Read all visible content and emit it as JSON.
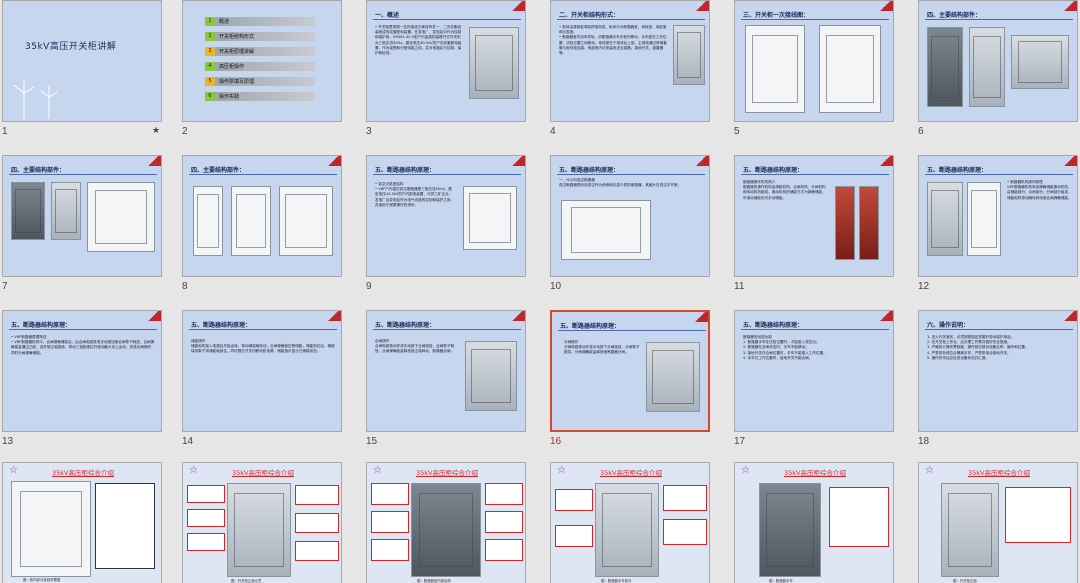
{
  "slides": [
    {
      "num": "1",
      "title": "35kV高压开关柜讲解",
      "marker": "★"
    },
    {
      "num": "2",
      "toc": [
        {
          "n": "1",
          "label": "概述"
        },
        {
          "n": "2",
          "label": "开关柜结构形式"
        },
        {
          "n": "3",
          "label": "开关柜原理讲解"
        },
        {
          "n": "4",
          "label": "高压柜操作"
        },
        {
          "n": "5",
          "label": "操作票填写原理"
        },
        {
          "n": "6",
          "label": "操作实践"
        }
      ]
    },
    {
      "num": "3",
      "heading": "一、概述",
      "body": "• 开关柜是按照一定的接线方案将有关一、二次设备组装而成的成套配电装置，在发电厂、变电站中作为控制和保护用。KYN61-40.5型户内金属铠装移开式开关柜为三相交流50Hz，额定电压40.5kV的户内成套配电装置，作为接受和分配电能之用，并对电路实行控制、保护和检测。"
    },
    {
      "num": "4",
      "heading": "二、开关柜结构形式：",
      "body": "• 柜体由薄钢板弯制拼接而成，柜体分为断路器室、母线室、电缆室和仪表室。\n• 断路器室内设有导轨，供断路器手车在柜内移动，手车能在工作位置、试验位置之间移动。母线室位于柜体后上部，主母线通过穿墙套管与相邻柜连接。电缆室内可安装电流互感器、接地开关、避雷器等。"
    },
    {
      "num": "5",
      "heading": "三、开关柜一次接线图：",
      "body": ""
    },
    {
      "num": "6",
      "heading": "四、主要结构部件：",
      "body": ""
    },
    {
      "num": "7",
      "heading": "四、主要结构部件：",
      "body": ""
    },
    {
      "num": "8",
      "heading": "四、主要结构部件：",
      "body": ""
    },
    {
      "num": "9",
      "heading": "五、断路器结构原理：",
      "body": "• 真空灭弧室结构\n• VBF户内高压真空断路器是三相交流50Hz，额定电压40.5kV的户内配电装置，可供工矿企业、发电厂及变电站作为电气设施的控制和保护之用，并适用于频繁操作的场所。"
    },
    {
      "num": "10",
      "heading": "五、断路器结构原理：",
      "body": "一、什么叫真空断路器\n真空断路器是利用真空作为绝缘和灭弧介质的断路器，其触头在真空中开断。"
    },
    {
      "num": "11",
      "heading": "五、断路器结构原理：",
      "body": "断路器操作机构简介\n断路器的操作机构由储能机构、合闸机构、分闸机构和传动机构组成。操动机构的储能方式为弹簧储能，可电动储能也可手动储能。"
    },
    {
      "num": "12",
      "heading": "五、断路器结构原理：",
      "body": "• 断路器机构操作原理\nVBF断路器机构采用弹簧储能操动机构，由储能部分、合闸部分、分闸部分组成，储能电机带动棘轮转动使合闸弹簧储能。"
    },
    {
      "num": "13",
      "heading": "五、断路器结构原理：",
      "body": "• VBF断路器原理简述\n• VBF断路器机构中，合闸弹簧储能后，由合闸电磁铁或手动按钮使合闸掣子释放，合闸弹簧能量通过凸轮、连杆使主轴旋转，带动三相绝缘拉杆使动触头向上运动，完成合闸操作，同时分闸弹簧储能。"
    },
    {
      "num": "14",
      "heading": "五、断路器结构原理：",
      "body": "储能操作\n储能电机接入电源后开始运转，带动储能轴转动，合闸弹簧被拉伸储能。储能到位后，储能保持掣子将储能轴锁住，同时限位开关切断电机电源，储能指示显示已储能状态。"
    },
    {
      "num": "15",
      "heading": "五、断路器结构原理：",
      "body": "合闸操作\n合闸电磁铁动作或手动按下合闸按钮，合闸掣子释放，合闸弹簧能量释放使主轴转动，断路器合闸。"
    },
    {
      "num": "16",
      "heading": "五、断路器结构原理：",
      "body": "分闸操作\n分闸电磁铁动作或手动按下分闸按钮，分闸掣子脱扣，分闸弹簧能量释放使断路器分闸。",
      "selected": true
    },
    {
      "num": "17",
      "heading": "五、断路器结构原理：",
      "body": "断路器的闭锁功能\n1. 断路器手车在试验位置时，才能推入或拉出；\n2. 断路器在合闸状态时，手车不能移动；\n3. 接地开关在合闸位置时，手车不能推入工作位置；\n4. 手车在工作位置时，接地开关不能合闸。"
    },
    {
      "num": "18",
      "heading": "六、操作说明：",
      "body": "1. 进入开关室前，必须按照规定穿戴好劳动保护用品。\n2. 在开关柜上作业，应办理工作票并做好安全措施。\n3. 严格执行操作票制度，操作前应核对设备名称、编号和位置。\n4. 严禁带负荷拉合隔离手车，严禁带电合接地开关。\n5. 操作完毕后应检查设备状态并汇报。"
    },
    {
      "num": "19",
      "bigtitle": "35kV高压柜综合介绍",
      "caption": "图：柜内部分接线布置图"
    },
    {
      "num": "20",
      "bigtitle": "35kV高压柜综合介绍",
      "caption": "图：开关柜正面示意"
    },
    {
      "num": "21",
      "bigtitle": "35kV高压柜综合介绍",
      "caption": "图：断路器室内部结构"
    },
    {
      "num": "22",
      "bigtitle": "35kV高压柜综合介绍",
      "caption": "图：断路器手车部分"
    },
    {
      "num": "23",
      "bigtitle": "35kV高压柜综合介绍",
      "caption": "图：断路器手车"
    },
    {
      "num": "24",
      "bigtitle": "35kV高压柜综合介绍",
      "caption": "图：开关柜正面"
    }
  ]
}
